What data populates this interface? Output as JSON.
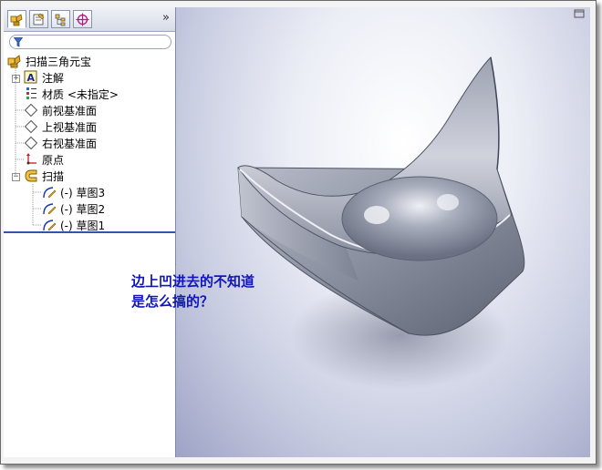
{
  "tabs": [
    {
      "name": "featuremanager",
      "icon": "feature-tree-icon"
    },
    {
      "name": "propertymanager",
      "icon": "property-icon"
    },
    {
      "name": "configurationmanager",
      "icon": "configuration-icon"
    },
    {
      "name": "dimxpert",
      "icon": "target-icon"
    }
  ],
  "more_label": "»",
  "tree": {
    "root": "扫描三角元宝",
    "items": [
      {
        "label": "注解",
        "icon": "annotation-icon"
      },
      {
        "label": "材质 <未指定>",
        "icon": "material-icon"
      },
      {
        "label": "前视基准面",
        "icon": "plane-icon"
      },
      {
        "label": "上视基准面",
        "icon": "plane-icon"
      },
      {
        "label": "右视基准面",
        "icon": "plane-icon"
      },
      {
        "label": "原点",
        "icon": "origin-icon"
      },
      {
        "label": "扫描",
        "icon": "sweep-icon"
      }
    ],
    "sweep_children": [
      {
        "label": "(-) 草图3",
        "icon": "sketch-icon"
      },
      {
        "label": "(-) 草图2",
        "icon": "sketch-icon"
      },
      {
        "label": "(-) 草图1",
        "icon": "sketch-icon"
      }
    ]
  },
  "note": {
    "line1": "边上凹进去的不知道",
    "line2": "是怎么搞的？"
  },
  "colors": {
    "note": "#1016b8",
    "rollback_bar": "#2f56a8",
    "part": "#9aa0ae"
  }
}
